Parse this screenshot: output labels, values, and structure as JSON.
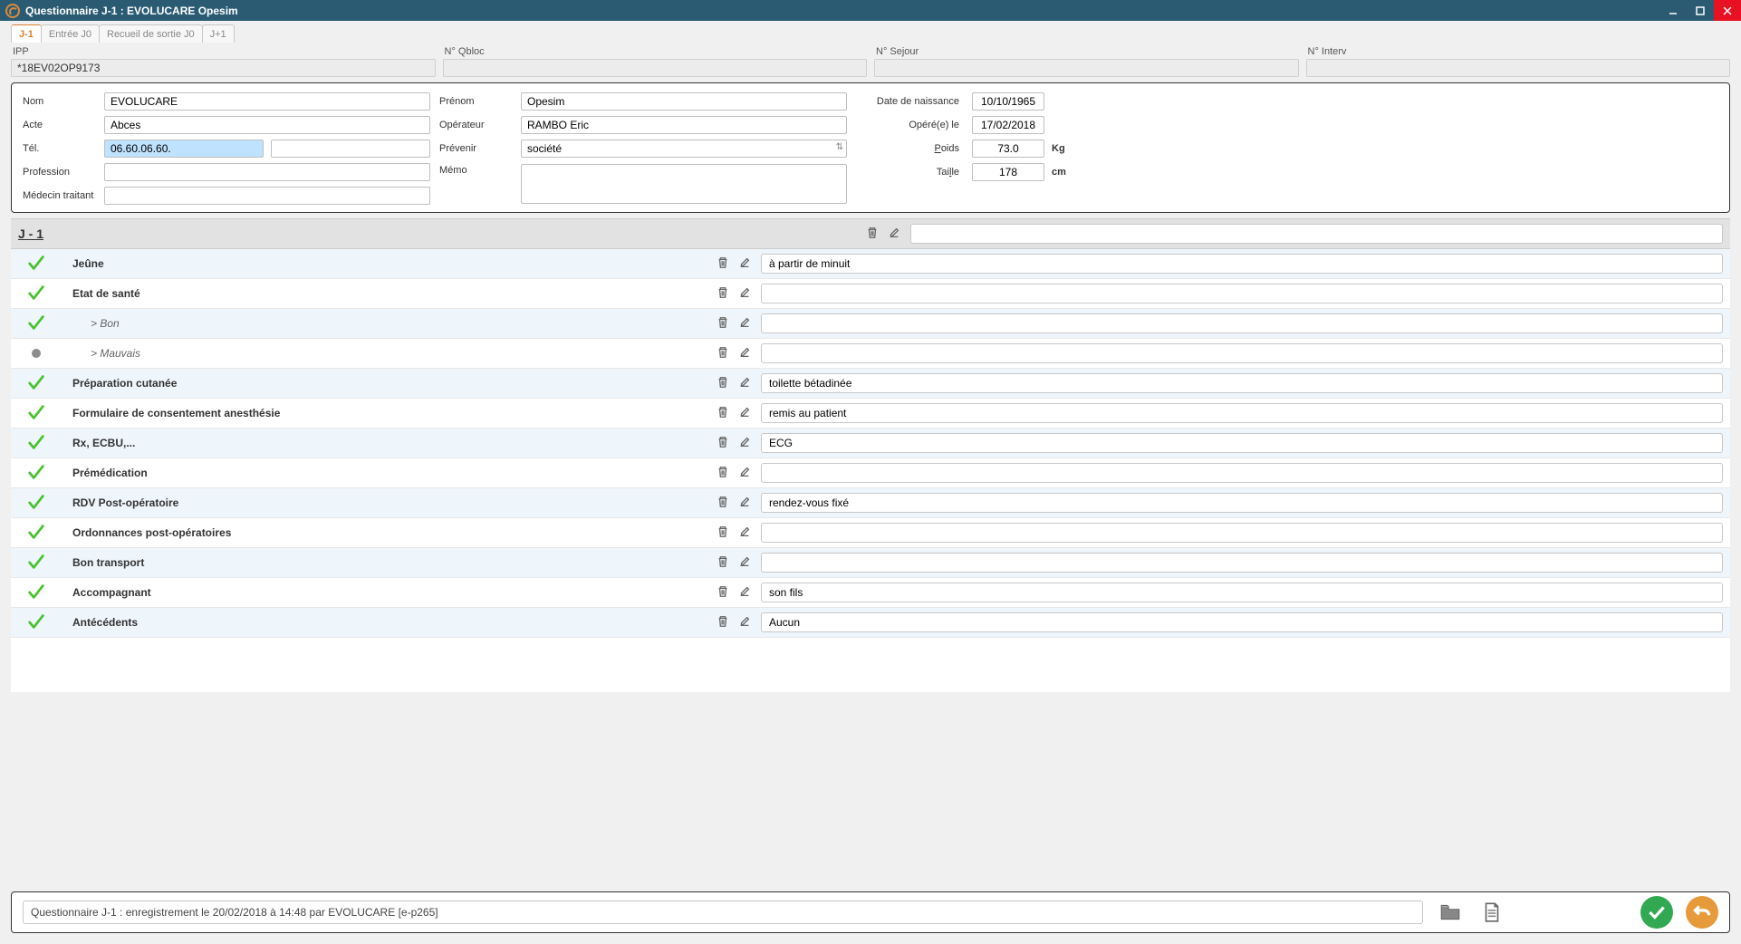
{
  "window": {
    "title": "Questionnaire J-1 : EVOLUCARE Opesim"
  },
  "tabs": [
    {
      "label": "J-1",
      "active": true
    },
    {
      "label": "Entrée J0",
      "active": false
    },
    {
      "label": "Recueil de sortie J0",
      "active": false
    },
    {
      "label": "J+1",
      "active": false
    }
  ],
  "ids": {
    "ipp_label": "IPP",
    "ipp_value": "*18EV02OP9173",
    "qbloc_label": "N° Qbloc",
    "qbloc_value": "",
    "sejour_label": "N° Sejour",
    "sejour_value": "",
    "interv_label": "N° Interv",
    "interv_value": ""
  },
  "patient": {
    "labels": {
      "nom": "Nom",
      "prenom": "Prénom",
      "acte": "Acte",
      "operateur": "Opérateur",
      "tel": "Tél.",
      "prevenir": "Prévenir",
      "profession": "Profession",
      "memo": "Mémo",
      "medecin": "Médecin traitant",
      "date_naissance": "Date de naissance",
      "opere_le": "Opéré(e) le",
      "poids": "Poids",
      "taille": "Taille",
      "kg": "Kg",
      "cm": "cm"
    },
    "values": {
      "nom": "EVOLUCARE",
      "prenom": "Opesim",
      "acte": "Abces",
      "operateur": "RAMBO Eric",
      "tel": "06.60.06.60.",
      "tel2": "",
      "prevenir": "société",
      "profession": "",
      "memo": "",
      "medecin": "",
      "date_naissance": "10/10/1965",
      "opere_le": "17/02/2018",
      "poids": "73.0",
      "taille": "178"
    }
  },
  "questionnaire": {
    "header_title": "J - 1",
    "header_value": "",
    "rows": [
      {
        "status": "check",
        "label": "Jeûne",
        "bold": true,
        "sub": false,
        "value": "à partir de minuit"
      },
      {
        "status": "check",
        "label": "Etat de santé",
        "bold": true,
        "sub": false,
        "value": ""
      },
      {
        "status": "check",
        "label": "> Bon",
        "bold": false,
        "sub": true,
        "value": ""
      },
      {
        "status": "dot",
        "label": "> Mauvais",
        "bold": false,
        "sub": true,
        "value": ""
      },
      {
        "status": "check",
        "label": "Préparation cutanée",
        "bold": true,
        "sub": false,
        "value": "toilette bétadinée"
      },
      {
        "status": "check",
        "label": "Formulaire de consentement anesthésie",
        "bold": true,
        "sub": false,
        "value": "remis au patient"
      },
      {
        "status": "check",
        "label": "Rx, ECBU,...",
        "bold": true,
        "sub": false,
        "value": "ECG"
      },
      {
        "status": "check",
        "label": "Prémédication",
        "bold": true,
        "sub": false,
        "value": ""
      },
      {
        "status": "check",
        "label": "RDV Post-opératoire",
        "bold": true,
        "sub": false,
        "value": "rendez-vous fixé"
      },
      {
        "status": "check",
        "label": "Ordonnances post-opératoires",
        "bold": true,
        "sub": false,
        "value": ""
      },
      {
        "status": "check",
        "label": "Bon transport",
        "bold": true,
        "sub": false,
        "value": ""
      },
      {
        "status": "check",
        "label": "Accompagnant",
        "bold": true,
        "sub": false,
        "value": "son fils"
      },
      {
        "status": "check",
        "label": "Antécédents",
        "bold": true,
        "sub": false,
        "value": "Aucun"
      }
    ]
  },
  "footer": {
    "log": "Questionnaire J-1 : enregistrement le 20/02/2018 à 14:48 par EVOLUCARE  [e-p265]"
  }
}
